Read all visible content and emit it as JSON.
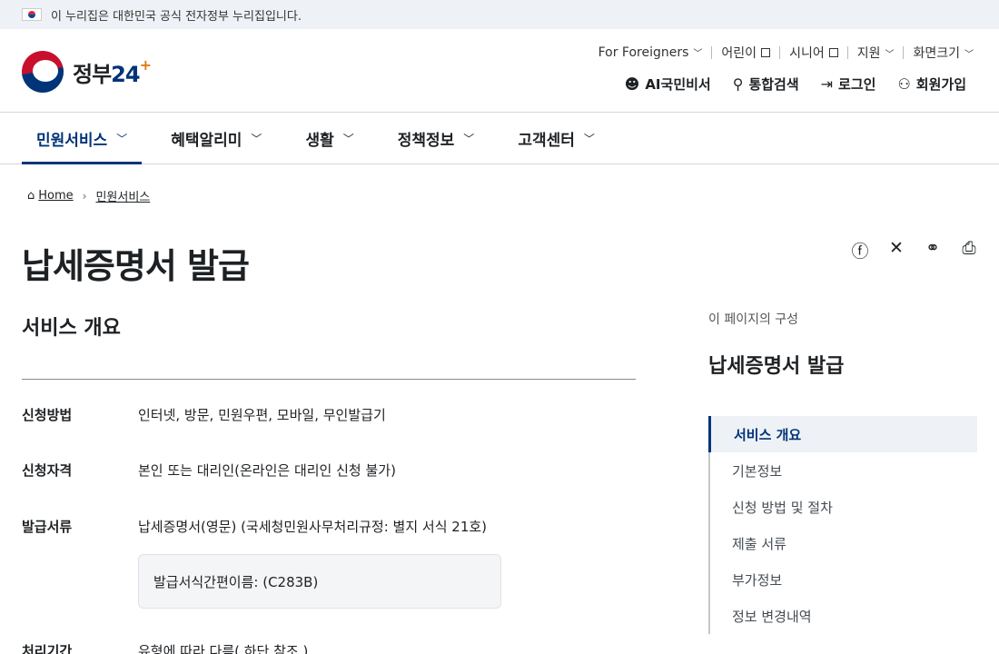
{
  "gov_banner": {
    "text": "이 누리집은 대한민국 공식 전자정부 누리집입니다."
  },
  "logo": {
    "text": "정부",
    "num": "24",
    "plus": "+"
  },
  "utility": {
    "items": [
      "For Foreigners",
      "어린이",
      "시니어",
      "지원",
      "화면크기"
    ]
  },
  "main_menu": {
    "ai": "AI국민비서",
    "search": "통합검색",
    "login": "로그인",
    "signup": "회원가입"
  },
  "gnb": [
    "민원서비스",
    "혜택알리미",
    "생활",
    "정책정보",
    "고객센터"
  ],
  "breadcrumb": {
    "home": "Home",
    "current": "민원서비스"
  },
  "page_title": "납세증명서 발급",
  "section": {
    "title": "서비스 개요",
    "rows": [
      {
        "label": "신청방법",
        "value": "인터넷, 방문, 민원우편, 모바일, 무인발급기"
      },
      {
        "label": "신청자격",
        "value": "본인 또는 대리인(온라인은 대리인 신청 불가)"
      },
      {
        "label": "발급서류",
        "value": "납세증명서(영문) (국세청민원사무처리규정: 별지 서식 21호)"
      },
      {
        "label": "처리기간",
        "value": "유형에 따라 다름( 하단 참조 )"
      }
    ],
    "box": "발급서식간편이름: (C283B)"
  },
  "toc": {
    "label": "이 페이지의 구성",
    "title": "납세증명서 발급",
    "items": [
      "서비스 개요",
      "기본정보",
      "신청 방법 및 절차",
      "제출 서류",
      "부가정보",
      "정보 변경내역"
    ]
  }
}
